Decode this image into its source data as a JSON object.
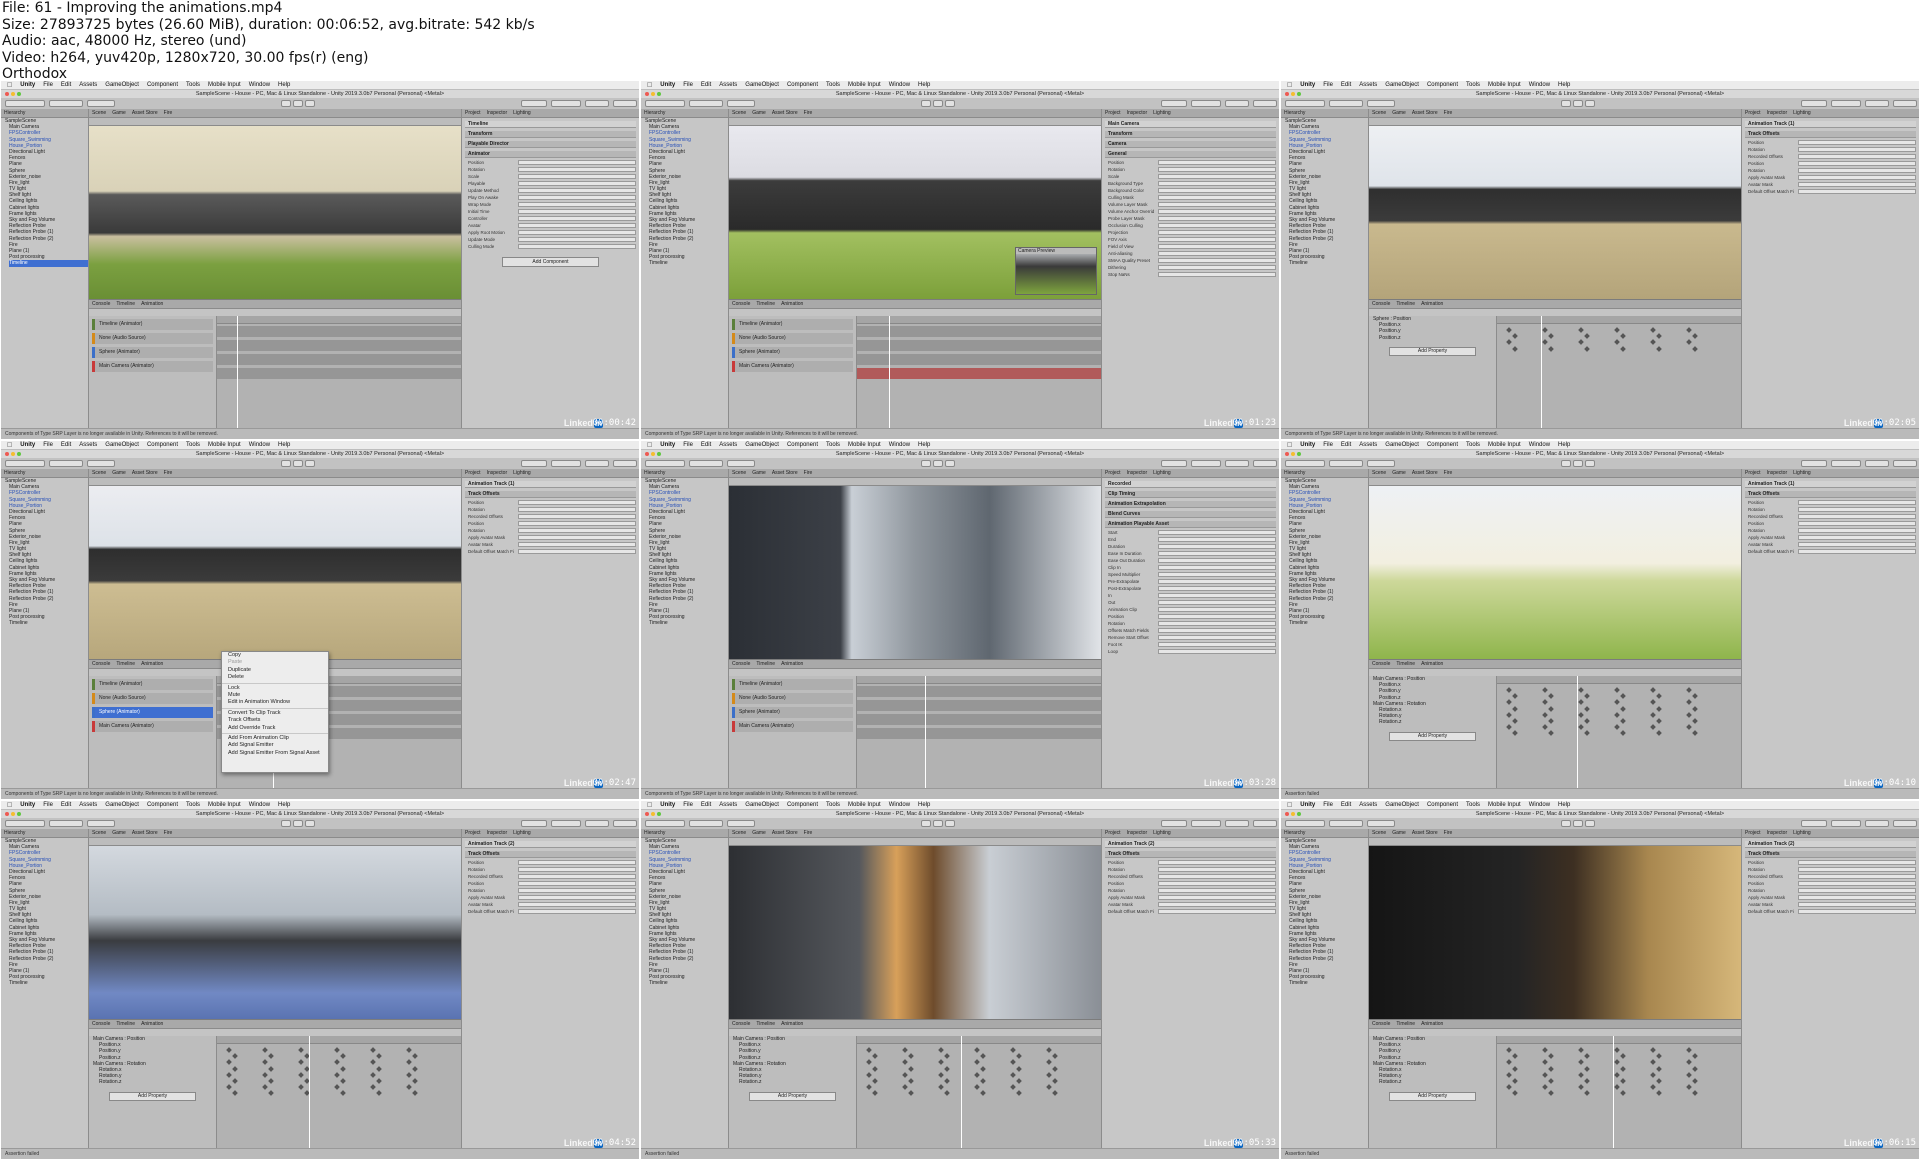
{
  "header": {
    "file_line": "File: 61 - Improving the animations.mp4",
    "size_line": "Size: 27893725 bytes (26.60 MiB), duration: 00:06:52, avg.bitrate: 542 kb/s",
    "audio_line": "Audio: aac, 48000 Hz, stereo (und)",
    "video_line": "Video: h264, yuv420p, 1280x720, 30.00 fps(r) (eng)",
    "brand_line": "Orthodox"
  },
  "common": {
    "mac_menu": [
      "Unity",
      "File",
      "Edit",
      "Assets",
      "GameObject",
      "Component",
      "Tools",
      "Mobile Input",
      "Window",
      "Help"
    ],
    "window_title": "SampleScene - House - PC, Mac & Linux Standalone - Unity 2019.3.0b7 Personal (Personal) <Metal>",
    "hierarchy_tab": "Hierarchy",
    "project_tab": "Project",
    "inspector_tab": "Inspector",
    "lighting_tab": "Lighting",
    "hierarchy_items": [
      "SampleScene",
      "Main Camera",
      "FPSController",
      "Square_Swimming",
      "House_Portion",
      "Directional Light",
      "Fences",
      "Plane",
      "Sphere",
      "Exterior_noise",
      "Fire_light",
      "TV light",
      "Shelf light",
      "Ceiling lights",
      "Cabinet lights",
      "Frame lights",
      "Sky and Fog Volume",
      "Reflection Probe",
      "Reflection Probe (1)",
      "Reflection Probe (2)",
      "Fire",
      "Plane (1)",
      "Post processing",
      "Timeline"
    ],
    "timeline_tracks": [
      "Timeline (Animator)",
      "None (Audio Source)",
      "Sphere (Animator)",
      "Main Camera (Animator)"
    ],
    "linkedin_text": "Linked",
    "linkedin_in": "in"
  },
  "tiles": [
    {
      "timestamp": "00:00:42",
      "scene_tabs": [
        "Scene",
        "Game",
        "Asset Store",
        "Fire"
      ],
      "bottom_tabs": [
        "Console",
        "Timeline",
        "Animation"
      ],
      "inspector_title": "Timeline",
      "inspector_sections": [
        "Transform",
        "Playable Director",
        "Animator"
      ],
      "inspector_rows": [
        "Position",
        "Rotation",
        "Scale",
        "Playable",
        "Update Method",
        "Play On Awake",
        "Wrap Mode",
        "Initial Time",
        "Controller",
        "Avatar",
        "Apply Root Motion",
        "Update Mode",
        "Culling Mode"
      ],
      "inspector_button": "Add Component",
      "status": "Components of Type SRP Layer is no longer available in Unity. References to it will be removed."
    },
    {
      "timestamp": "00:01:23",
      "scene_tabs": [
        "Scene",
        "Game",
        "Asset Store",
        "Fire"
      ],
      "bottom_tabs": [
        "Console",
        "Timeline",
        "Animation"
      ],
      "inspector_title": "Main Camera",
      "inspector_sections": [
        "Transform",
        "Camera",
        "General"
      ],
      "inspector_rows": [
        "Position",
        "Rotation",
        "Scale",
        "Background Type",
        "Background Color",
        "Culling Mask",
        "Volume Layer Mask",
        "Volume Anchor Override",
        "Probe Layer Mask",
        "Occlusion Culling",
        "Projection",
        "FOV Axis",
        "Field of View",
        "Anti-aliasing",
        "SMAA Quality Preset",
        "Dithering",
        "Stop NaNs"
      ],
      "preview_label": "Camera Preview",
      "status": "Components of Type SRP Layer is no longer available in Unity. References to it will be removed."
    },
    {
      "timestamp": "00:02:05",
      "scene_tabs": [
        "Scene",
        "Game",
        "Asset Store",
        "Fire"
      ],
      "bottom_tabs": [
        "Console",
        "Timeline",
        "Animation"
      ],
      "inspector_title": "Animation Track (1)",
      "inspector_sections": [
        "Track Offsets"
      ],
      "inspector_rows": [
        "Position",
        "Rotation",
        "Recorded Offsets",
        "Position",
        "Rotation",
        "Apply Avatar Mask",
        "Avatar Mask",
        "Default Offset Match Fields"
      ],
      "anim_props": [
        "Sphere : Position",
        "Position.x",
        "Position.y",
        "Position.z"
      ],
      "anim_button": "Add Property",
      "status": "Components of Type SRP Layer is no longer available in Unity. References to it will be removed."
    },
    {
      "timestamp": "00:02:47",
      "scene_tabs": [
        "Scene",
        "Game",
        "Asset Store",
        "Fire"
      ],
      "bottom_tabs": [
        "Console",
        "Timeline",
        "Animation"
      ],
      "inspector_title": "Animation Track (1)",
      "inspector_sections": [
        "Track Offsets"
      ],
      "inspector_rows": [
        "Position",
        "Rotation",
        "Recorded Offsets",
        "Position",
        "Rotation",
        "Apply Avatar Mask",
        "Avatar Mask",
        "Default Offset Match Fields"
      ],
      "context_menu": [
        "Copy",
        "Paste",
        "Duplicate",
        "Delete",
        "Lock",
        "Mute",
        "Edit in Animation Window",
        "Convert To Clip Track",
        "Track Offsets",
        "Add Override Track",
        "Add From Animation Clip",
        "Add Signal Emitter",
        "Add Signal Emitter From Signal Asset"
      ],
      "status": "Components of Type SRP Layer is no longer available in Unity. References to it will be removed."
    },
    {
      "timestamp": "00:03:28",
      "scene_tabs": [
        "Scene",
        "Game",
        "Asset Store",
        "Fire"
      ],
      "bottom_tabs": [
        "Console",
        "Timeline",
        "Animation"
      ],
      "inspector_title": "Recorded",
      "inspector_sections": [
        "Clip Timing",
        "Animation Extrapolation",
        "Blend Curves",
        "Animation Playable Asset"
      ],
      "inspector_rows": [
        "Start",
        "End",
        "Duration",
        "Ease In Duration",
        "Ease Out Duration",
        "Clip In",
        "Speed Multiplier",
        "Pre-Extrapolate",
        "Post-Extrapolate",
        "In",
        "Out",
        "Animation Clip",
        "Position",
        "Rotation",
        "Offsets Match Fields",
        "Remove Start Offset",
        "Foot IK",
        "Loop"
      ],
      "status": "Components of Type SRP Layer is no longer available in Unity. References to it will be removed."
    },
    {
      "timestamp": "00:04:10",
      "scene_tabs": [
        "Scene",
        "Game",
        "Asset Store",
        "Fire"
      ],
      "bottom_tabs": [
        "Console",
        "Timeline",
        "Animation"
      ],
      "inspector_title": "Animation Track (1)",
      "inspector_sections": [
        "Track Offsets"
      ],
      "inspector_rows": [
        "Position",
        "Rotation",
        "Recorded Offsets",
        "Position",
        "Rotation",
        "Apply Avatar Mask",
        "Avatar Mask",
        "Default Offset Match Fields"
      ],
      "anim_props": [
        "Main Camera : Position",
        "Position.x",
        "Position.y",
        "Position.z",
        "Main Camera : Rotation",
        "Rotation.x",
        "Rotation.y",
        "Rotation.z"
      ],
      "anim_button": "Add Property",
      "status": "Assertion failed"
    },
    {
      "timestamp": "00:04:52",
      "scene_tabs": [
        "Scene",
        "Game",
        "Asset Store",
        "Fire"
      ],
      "bottom_tabs": [
        "Console",
        "Timeline",
        "Animation"
      ],
      "inspector_title": "Animation Track (2)",
      "inspector_sections": [
        "Track Offsets"
      ],
      "inspector_rows": [
        "Position",
        "Rotation",
        "Recorded Offsets",
        "Position",
        "Rotation",
        "Apply Avatar Mask",
        "Avatar Mask",
        "Default Offset Match Fields"
      ],
      "anim_props": [
        "Main Camera : Position",
        "Position.x",
        "Position.y",
        "Position.z",
        "Main Camera : Rotation",
        "Rotation.x",
        "Rotation.y",
        "Rotation.z"
      ],
      "anim_button": "Add Property",
      "status": "Assertion failed"
    },
    {
      "timestamp": "00:05:33",
      "scene_tabs": [
        "Scene",
        "Game",
        "Asset Store",
        "Fire"
      ],
      "bottom_tabs": [
        "Console",
        "Timeline",
        "Animation"
      ],
      "inspector_title": "Animation Track (2)",
      "inspector_sections": [
        "Track Offsets"
      ],
      "inspector_rows": [
        "Position",
        "Rotation",
        "Recorded Offsets",
        "Position",
        "Rotation",
        "Apply Avatar Mask",
        "Avatar Mask",
        "Default Offset Match Fields"
      ],
      "anim_props": [
        "Main Camera : Position",
        "Position.x",
        "Position.y",
        "Position.z",
        "Main Camera : Rotation",
        "Rotation.x",
        "Rotation.y",
        "Rotation.z"
      ],
      "anim_button": "Add Property",
      "status": "Assertion failed"
    },
    {
      "timestamp": "00:06:15",
      "scene_tabs": [
        "Scene",
        "Game",
        "Asset Store",
        "Fire"
      ],
      "bottom_tabs": [
        "Console",
        "Timeline",
        "Animation"
      ],
      "inspector_title": "Animation Track (2)",
      "inspector_sections": [
        "Track Offsets"
      ],
      "inspector_rows": [
        "Position",
        "Rotation",
        "Recorded Offsets",
        "Position",
        "Rotation",
        "Apply Avatar Mask",
        "Avatar Mask",
        "Default Offset Match Fields"
      ],
      "anim_props": [
        "Main Camera : Position",
        "Position.x",
        "Position.y",
        "Position.z",
        "Main Camera : Rotation",
        "Rotation.x",
        "Rotation.y",
        "Rotation.z"
      ],
      "anim_button": "Add Property",
      "status": "Assertion failed"
    }
  ]
}
